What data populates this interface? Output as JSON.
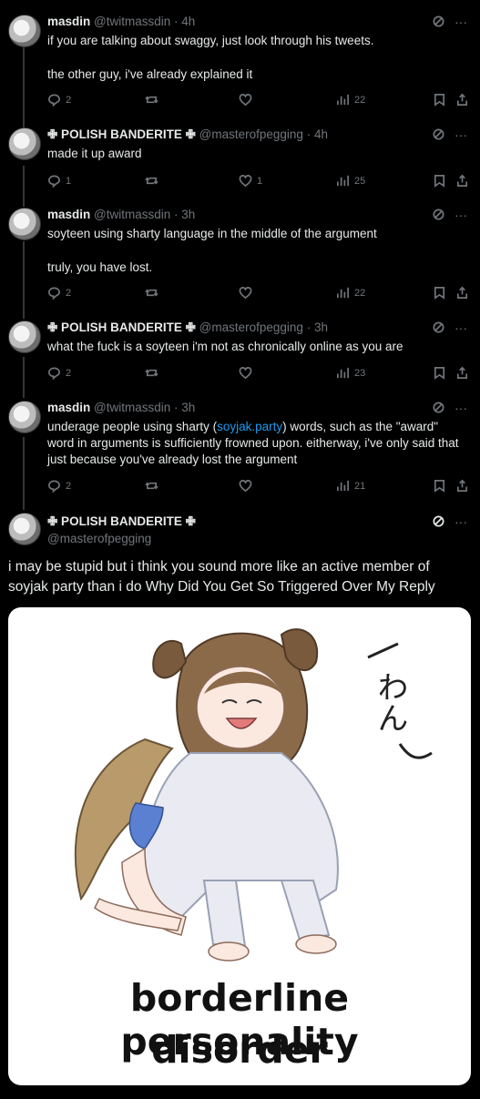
{
  "tweets": [
    {
      "name": "masdin",
      "handle": "@twitmassdin",
      "time": "· 4h",
      "lines": [
        "if you are talking about swaggy, just look through his tweets.",
        "the other guy, i've already explained it"
      ],
      "replies": "2",
      "likes": "",
      "views": "22"
    },
    {
      "name": "✙ POLISH BANDERITE ✙",
      "handle": "@masterofpegging",
      "time": "· 4h",
      "lines": [
        "made it up award"
      ],
      "replies": "1",
      "likes": "1",
      "views": "25"
    },
    {
      "name": "masdin",
      "handle": "@twitmassdin",
      "time": "· 3h",
      "lines": [
        "soyteen using sharty language in the middle of the argument",
        "truly, you have lost."
      ],
      "replies": "2",
      "likes": "",
      "views": "22"
    },
    {
      "name": "✙ POLISH BANDERITE ✙",
      "handle": "@masterofpegging",
      "time": "· 3h",
      "lines": [
        "what the fuck is a soyteen i'm not as chronically online as you are"
      ],
      "replies": "2",
      "likes": "",
      "views": "23"
    },
    {
      "name": "masdin",
      "handle": "@twitmassdin",
      "time": "· 3h",
      "pre": "underage people using sharty (",
      "link": "soyjak.party",
      "post": ") words, such as the \"award\" word in arguments is sufficiently frowned upon. eitherway, i've only said that just because you've already lost the argument",
      "replies": "2",
      "likes": "",
      "views": "21"
    }
  ],
  "main": {
    "name": "✙ POLISH BANDERITE ✙",
    "handle": "@masterofpegging",
    "text": "i may be stupid but i think you sound more like an active member of soyjak party than i do Why Did You Get So Triggered Over My Reply",
    "image_caption_1": "borderline personality",
    "image_caption_2": "disorder",
    "image_kana": "わん"
  }
}
